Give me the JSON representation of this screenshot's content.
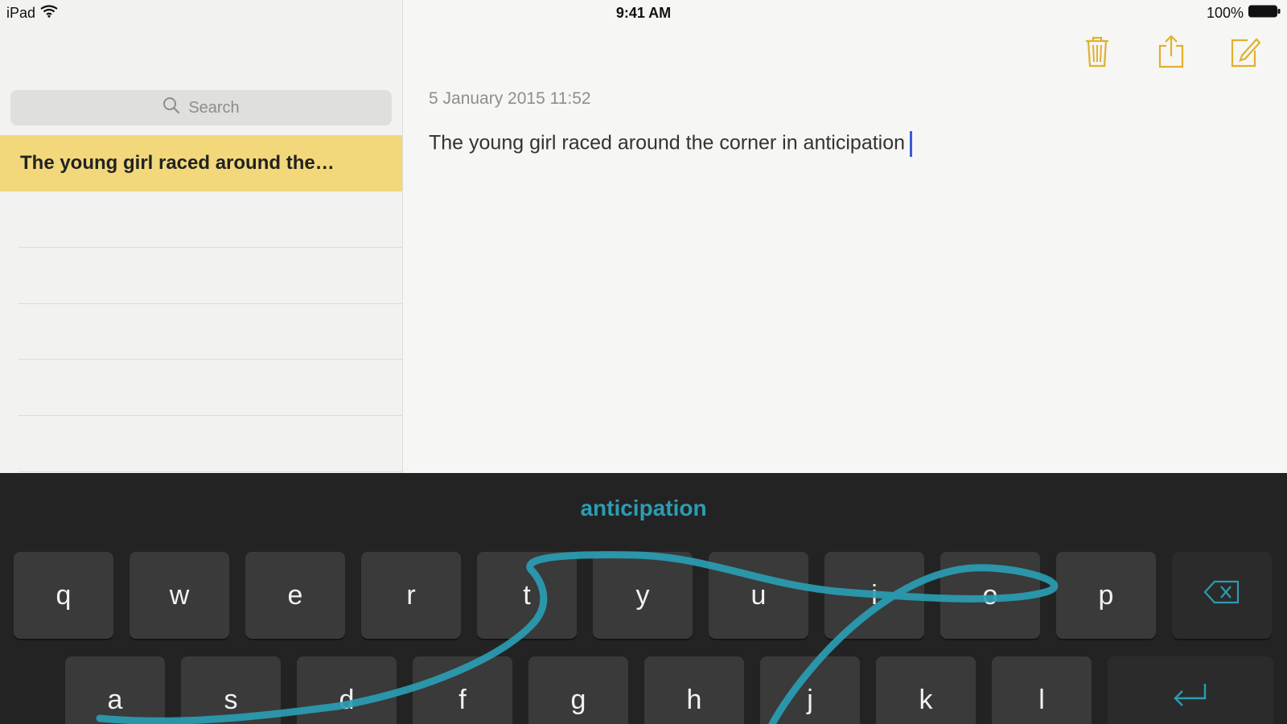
{
  "status_bar": {
    "device": "iPad",
    "time": "9:41 AM",
    "battery": "100%",
    "wifi_icon": "wifi-icon",
    "battery_icon": "battery-icon"
  },
  "sidebar": {
    "search_placeholder": "Search",
    "notes": [
      {
        "title": "The young girl raced around the…",
        "selected": true
      }
    ]
  },
  "note": {
    "date": "5 January 2015 11:52",
    "body": "The young girl raced around the corner in anticipation"
  },
  "toolbar": {
    "icons": [
      "trash-icon",
      "share-icon",
      "compose-icon"
    ],
    "accent_color": "#e0b12e"
  },
  "keyboard": {
    "suggestion": "anticipation",
    "trail_color": "#2a9db3",
    "row1": [
      "q",
      "w",
      "e",
      "r",
      "t",
      "y",
      "u",
      "i",
      "o",
      "p"
    ],
    "row2": [
      "a",
      "s",
      "d",
      "f",
      "g",
      "h",
      "j",
      "k",
      "l"
    ],
    "special_icons": [
      "backspace-icon",
      "return-icon"
    ]
  }
}
